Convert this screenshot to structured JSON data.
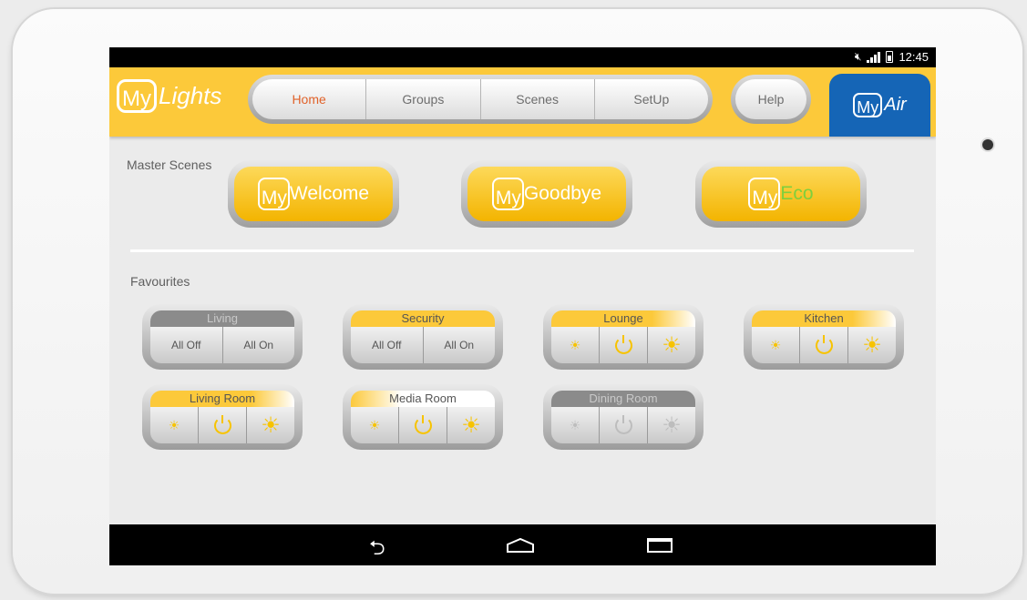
{
  "status": {
    "time": "12:45",
    "mute_icon": "mute-icon",
    "signal_icon": "signal-icon",
    "battery_icon": "battery-icon"
  },
  "header": {
    "logo": {
      "my": "My",
      "brand": "Lights"
    },
    "tabs": [
      {
        "label": "Home",
        "active": true
      },
      {
        "label": "Groups"
      },
      {
        "label": "Scenes"
      },
      {
        "label": "SetUp"
      }
    ],
    "help": "Help",
    "myair": {
      "my": "My",
      "brand": "Air"
    },
    "colors": {
      "header_bg": "#fcc93a",
      "active_tab": "#e0622a",
      "myair_bg": "#1565b6"
    }
  },
  "master_scenes": {
    "label": "Master Scenes",
    "buttons": [
      {
        "my": "My",
        "name": "Welcome"
      },
      {
        "my": "My",
        "name": "Goodbye"
      },
      {
        "my": "My",
        "name": "Eco",
        "name_color": "#7ecf3d"
      }
    ]
  },
  "favourites": {
    "label": "Favourites",
    "items": [
      {
        "title": "Living",
        "type": "switch",
        "off": "All Off",
        "on": "All On",
        "state": "disabled"
      },
      {
        "title": "Security",
        "type": "switch",
        "off": "All Off",
        "on": "All On",
        "state": "on"
      },
      {
        "title": "Lounge",
        "type": "dimmer",
        "state": "on"
      },
      {
        "title": "Kitchen",
        "type": "dimmer",
        "state": "on"
      },
      {
        "title": "Living Room",
        "type": "dimmer",
        "state": "on"
      },
      {
        "title": "Media Room",
        "type": "dimmer",
        "state": "partial"
      },
      {
        "title": "Dining Room",
        "type": "dimmer",
        "state": "disabled"
      }
    ]
  },
  "navbar": {
    "back_icon": "back-icon",
    "home_icon": "home-icon",
    "recents_icon": "recents-icon"
  }
}
